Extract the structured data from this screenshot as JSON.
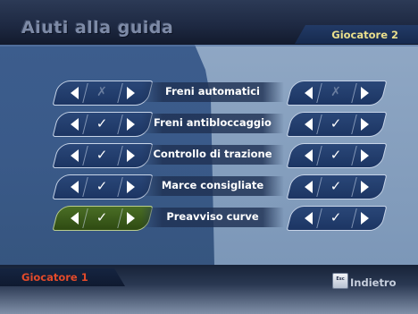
{
  "header": {
    "title": "Aiuti alla guida",
    "player2_label": "Giocatore 2"
  },
  "rows": [
    {
      "label": "Freni automatici",
      "p1": "✗",
      "p2": "✗"
    },
    {
      "label": "Freni antibloccaggio",
      "p1": "✓",
      "p2": "✓"
    },
    {
      "label": "Controllo di trazione",
      "p1": "✓",
      "p2": "✓"
    },
    {
      "label": "Marce consigliate",
      "p1": "✓",
      "p2": "✓"
    },
    {
      "label": "Preavviso curve",
      "p1": "✓",
      "p2": "✓"
    }
  ],
  "footer": {
    "player1_label": "Giocatore 1",
    "esc_key": "Esc",
    "back_label": "Indietro"
  },
  "colors": {
    "player1": "#e24a2a",
    "player2": "#eadf8c",
    "active_selector": "#3f6320",
    "selector": "#23406f"
  },
  "icons": {
    "left": "arrow-left-icon",
    "right": "arrow-right-icon"
  }
}
